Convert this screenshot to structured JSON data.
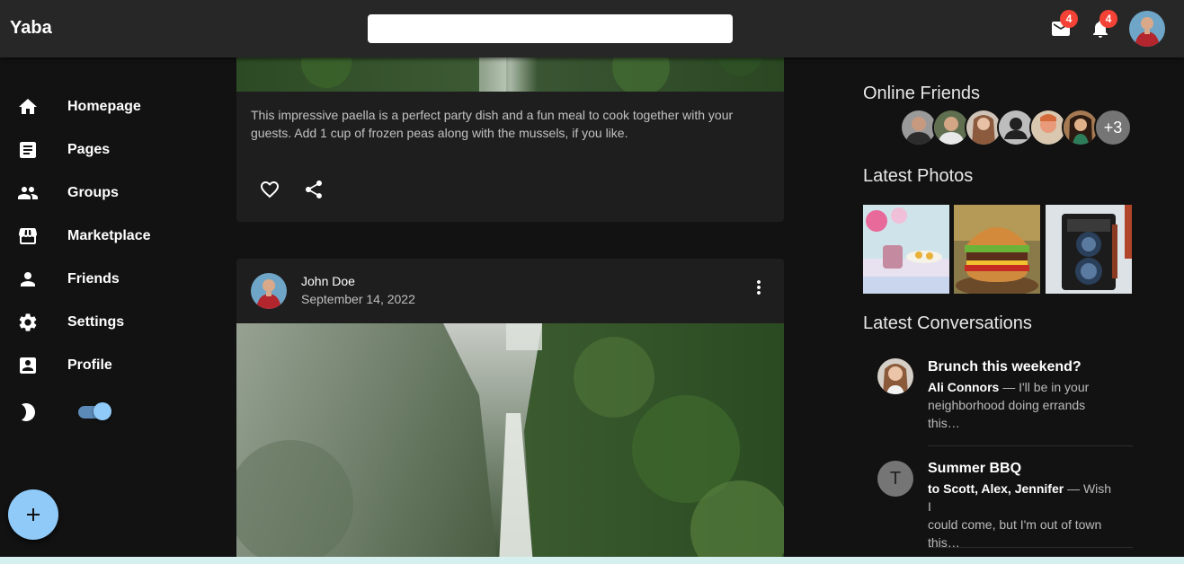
{
  "app": {
    "title": "Yaba"
  },
  "search": {
    "placeholder": "",
    "value": ""
  },
  "header": {
    "mail_badge": "4",
    "notifications_badge": "4"
  },
  "sidebar": {
    "items": [
      {
        "label": "Homepage",
        "icon": "home-icon"
      },
      {
        "label": "Pages",
        "icon": "article-icon"
      },
      {
        "label": "Groups",
        "icon": "groups-icon"
      },
      {
        "label": "Marketplace",
        "icon": "storefront-icon"
      },
      {
        "label": "Friends",
        "icon": "person-icon"
      },
      {
        "label": "Settings",
        "icon": "settings-icon"
      },
      {
        "label": "Profile",
        "icon": "account-box-icon"
      }
    ],
    "dark_mode": {
      "icon": "moon-icon",
      "enabled": true
    },
    "fab": {
      "label": "+"
    }
  },
  "feed": {
    "post1": {
      "text": "This impressive paella is a perfect party dish and a fun meal to cook together with your guests. Add 1 cup of frozen peas along with the mussels, if you like."
    },
    "post2": {
      "author": "John Doe",
      "date": "September 14, 2022"
    }
  },
  "right": {
    "online_friends_title": "Online Friends",
    "online_more": "+3",
    "latest_photos_title": "Latest Photos",
    "latest_conversations_title": "Latest Conversations",
    "conversations": [
      {
        "title": "Brunch this weekend?",
        "from": "Ali Connors",
        "line1": " — I'll be in your",
        "line2": "neighborhood doing errands",
        "line3": "this…"
      },
      {
        "title": "Summer BBQ",
        "from": "to Scott, Alex, Jennifer",
        "avatar_letter": "T",
        "line1": " — Wish I",
        "line2": "could come, but I'm out of town",
        "line3": "this…"
      }
    ]
  },
  "colors": {
    "accent": "#90caf9",
    "badge": "#f44336",
    "appbar": "#272727",
    "card": "#1e1e1e"
  }
}
